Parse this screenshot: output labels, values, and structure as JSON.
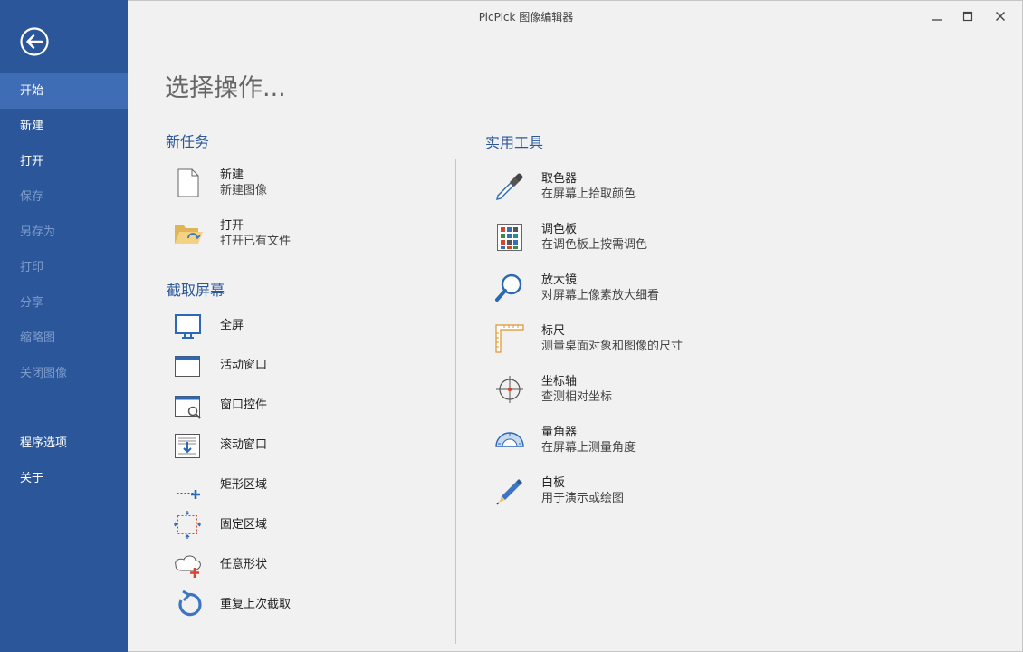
{
  "window": {
    "title": "PicPick 图像编辑器"
  },
  "sidebar": {
    "items": [
      {
        "label": "开始",
        "state": "active"
      },
      {
        "label": "新建",
        "state": "enabled"
      },
      {
        "label": "打开",
        "state": "enabled"
      },
      {
        "label": "保存",
        "state": "disabled"
      },
      {
        "label": "另存为",
        "state": "disabled"
      },
      {
        "label": "打印",
        "state": "disabled"
      },
      {
        "label": "分享",
        "state": "disabled"
      },
      {
        "label": "缩略图",
        "state": "disabled"
      },
      {
        "label": "关闭图像",
        "state": "disabled"
      },
      {
        "label": "程序选项",
        "state": "enabled"
      },
      {
        "label": "关于",
        "state": "enabled"
      }
    ]
  },
  "main": {
    "title": "选择操作...",
    "new_task": {
      "title": "新任务",
      "items": [
        {
          "label": "新建",
          "desc": "新建图像",
          "icon": "blank-page-icon"
        },
        {
          "label": "打开",
          "desc": "打开已有文件",
          "icon": "open-folder-icon"
        }
      ]
    },
    "capture": {
      "title": "截取屏幕",
      "items": [
        {
          "label": "全屏",
          "icon": "monitor-icon"
        },
        {
          "label": "活动窗口",
          "icon": "window-icon"
        },
        {
          "label": "窗口控件",
          "icon": "window-control-icon"
        },
        {
          "label": "滚动窗口",
          "icon": "scroll-window-icon"
        },
        {
          "label": "矩形区域",
          "icon": "rectangle-region-icon"
        },
        {
          "label": "固定区域",
          "icon": "fixed-region-icon"
        },
        {
          "label": "任意形状",
          "icon": "freehand-shape-icon"
        },
        {
          "label": "重复上次截取",
          "icon": "repeat-capture-icon"
        }
      ]
    },
    "tools": {
      "title": "实用工具",
      "items": [
        {
          "label": "取色器",
          "desc": "在屏幕上拾取颜色",
          "icon": "eyedropper-icon"
        },
        {
          "label": "调色板",
          "desc": "在调色板上按需调色",
          "icon": "color-palette-icon"
        },
        {
          "label": "放大镜",
          "desc": "对屏幕上像素放大细看",
          "icon": "magnifier-icon"
        },
        {
          "label": "标尺",
          "desc": "测量桌面对象和图像的尺寸",
          "icon": "ruler-icon"
        },
        {
          "label": "坐标轴",
          "desc": "查测相对坐标",
          "icon": "crosshair-icon"
        },
        {
          "label": "量角器",
          "desc": "在屏幕上测量角度",
          "icon": "protractor-icon"
        },
        {
          "label": "白板",
          "desc": "用于演示或绘图",
          "icon": "pen-icon"
        }
      ]
    }
  },
  "colors": {
    "sidebar_bg": "#2b579a",
    "sidebar_active": "#3e6db5",
    "accent": "#2b579a",
    "content_bg": "#f1f1f1"
  }
}
